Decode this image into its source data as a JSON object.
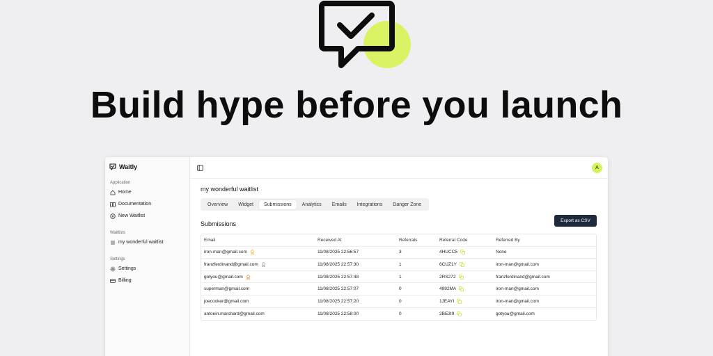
{
  "hero": {
    "title": "Build hype before you launch",
    "accent_color": "#d9f365"
  },
  "brand": {
    "name": "Waitly"
  },
  "sidebar": {
    "groups": [
      {
        "label": "Application",
        "items": [
          {
            "label": "Home",
            "icon": "home-icon"
          },
          {
            "label": "Documentation",
            "icon": "book-icon"
          },
          {
            "label": "New Waitlist",
            "icon": "plus-circle-icon"
          }
        ]
      },
      {
        "label": "Waitlists",
        "items": [
          {
            "label": "my wonderful waitlist",
            "icon": "list-icon"
          }
        ]
      },
      {
        "label": "Settings",
        "items": [
          {
            "label": "Settings",
            "icon": "gear-icon"
          },
          {
            "label": "Billing",
            "icon": "card-icon"
          }
        ]
      }
    ]
  },
  "header": {
    "avatar_initial": "A"
  },
  "main": {
    "waitlist_title": "my wonderful waitlist",
    "tabs": [
      {
        "label": "Overview"
      },
      {
        "label": "Widget"
      },
      {
        "label": "Submissions",
        "active": true
      },
      {
        "label": "Analytics"
      },
      {
        "label": "Emails"
      },
      {
        "label": "Integrations"
      },
      {
        "label": "Danger Zone"
      }
    ],
    "section_title": "Submissions",
    "export_label": "Export as CSV"
  },
  "table": {
    "columns": [
      "Email",
      "Received At",
      "Referrals",
      "Referral Code",
      "Referred By"
    ],
    "rows": [
      {
        "email": "iron-man@gmail.com",
        "badge": "gold",
        "received": "11/08/2025 22:56:57",
        "referrals": "3",
        "code": "4HUCC5",
        "referred_by": "None"
      },
      {
        "email": "franzferdinand@gmail.com",
        "badge": "silver",
        "received": "11/08/2025 22:57:30",
        "referrals": "1",
        "code": "6CUZ1Y",
        "referred_by": "iron-man@gmail.com"
      },
      {
        "email": "gotyou@gmail.com",
        "badge": "bronze",
        "received": "11/08/2025 22:57:48",
        "referrals": "1",
        "code": "2RS272",
        "referred_by": "franzferdinand@gmail.com"
      },
      {
        "email": "superman@gmail.com",
        "badge": "",
        "received": "11/08/2025 22:57:07",
        "referrals": "0",
        "code": "4992MA",
        "referred_by": "iron-man@gmail.com"
      },
      {
        "email": "joecooker@gmail.com",
        "badge": "",
        "received": "11/08/2025 22:57:20",
        "referrals": "0",
        "code": "1JEAYI",
        "referred_by": "iron-man@gmail.com"
      },
      {
        "email": "antonin.marchard@gmail.com",
        "badge": "",
        "received": "11/08/2025 22:58:00",
        "referrals": "0",
        "code": "2BE3I9",
        "referred_by": "gotyou@gmail.com"
      }
    ]
  },
  "colors": {
    "gold": "#f5b731",
    "silver": "#9aa0a6",
    "bronze": "#e3913e",
    "copy": "#c6e33b",
    "button": "#1e293b"
  }
}
